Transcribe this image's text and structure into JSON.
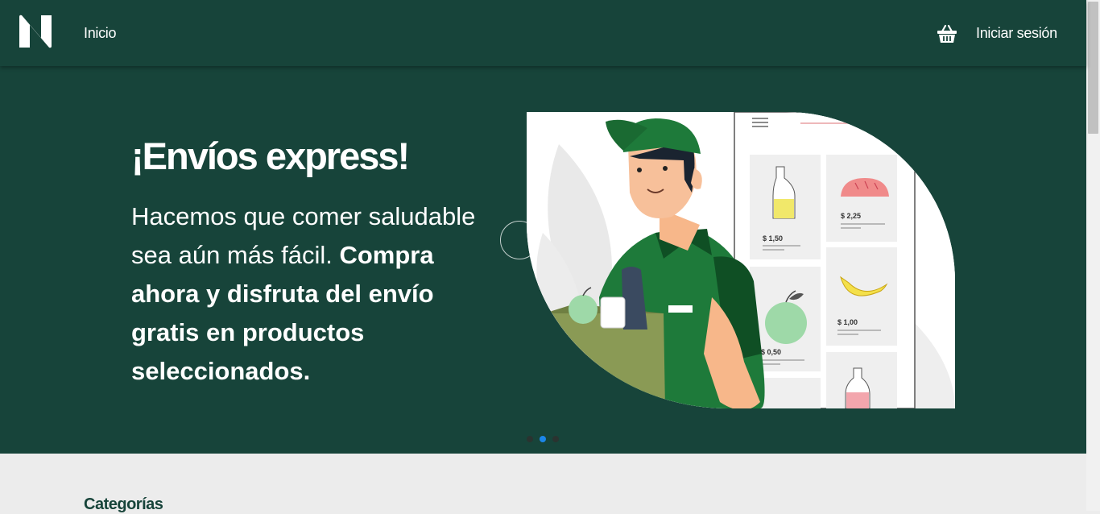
{
  "nav": {
    "home_label": "Inicio",
    "login_label": "Iniciar sesión",
    "logo_icon": "n-logo",
    "cart_icon": "basket-icon"
  },
  "hero": {
    "title": "¡Envíos express!",
    "text_regular": "Hacemos que comer saludable sea aún más fácil.",
    "text_bold": "Compra ahora y disfruta del envío gratis en productos seleccionados.",
    "carousel_active_index": 1,
    "carousel_count": 3,
    "illustration_prices": [
      "$ 1,50",
      "$ 2,25",
      "$ 0,50",
      "$ 1,00"
    ]
  },
  "categories": {
    "title": "Categorías"
  },
  "colors": {
    "brand_dark_green": "#17443a",
    "page_bg": "#ececec",
    "active_dot": "#1c86e8"
  }
}
